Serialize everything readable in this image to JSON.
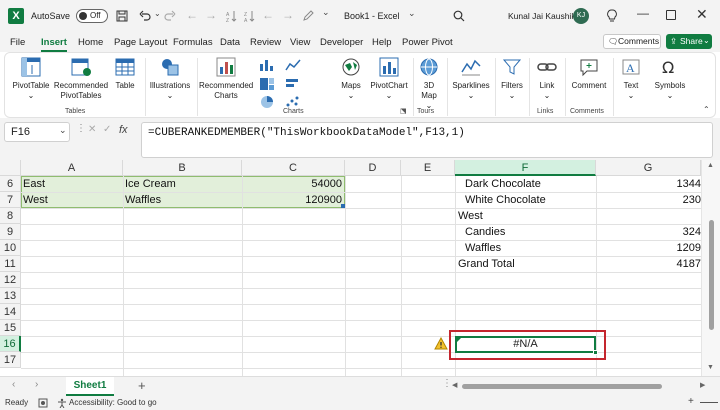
{
  "titlebar": {
    "autosave_label": "AutoSave",
    "autosave_state": "Off",
    "doc_title": "Book1 - Excel",
    "user_name": "Kunal Jai Kaushik",
    "user_initials": "KJ"
  },
  "menu": {
    "tabs": [
      "File",
      "Insert",
      "Home",
      "Page Layout",
      "Formulas",
      "Data",
      "Review",
      "View",
      "Developer",
      "Help",
      "Power Pivot"
    ],
    "active": "Insert",
    "comments_label": "Comments",
    "share_label": "Share"
  },
  "ribbon": {
    "pivottable": "PivotTable",
    "recommended_pivottables_1": "Recommended",
    "recommended_pivottables_2": "PivotTables",
    "table": "Table",
    "group_tables": "Tables",
    "illustrations": "Illustrations",
    "recommended_charts_1": "Recommended",
    "recommended_charts_2": "Charts",
    "maps": "Maps",
    "pivotchart": "PivotChart",
    "group_charts": "Charts",
    "map3d_1": "3D",
    "map3d_2": "Map",
    "group_tours": "Tours",
    "sparklines": "Sparklines",
    "filters": "Filters",
    "link": "Link",
    "group_links": "Links",
    "comment": "Comment",
    "group_comments": "Comments",
    "text": "Text",
    "symbols": "Symbols"
  },
  "formula_bar": {
    "name_box": "F16",
    "fx": "fx",
    "formula": "=CUBERANKEDMEMBER(\"ThisWorkbookDataModel\",F13,1)"
  },
  "grid": {
    "columns": [
      "A",
      "B",
      "C",
      "D",
      "E",
      "F",
      "G"
    ],
    "selected_column": "F",
    "rows": [
      "6",
      "7",
      "8",
      "9",
      "10",
      "11",
      "12",
      "13",
      "14",
      "15",
      "16",
      "17"
    ],
    "selected_row": "16",
    "left_table": [
      {
        "region": "East",
        "product": "Ice Cream",
        "amount": "54000"
      },
      {
        "region": "West",
        "product": "Waffles",
        "amount": "120900"
      }
    ],
    "pivot": [
      {
        "label": "Dark Chocolate",
        "value": "1344",
        "indent": true
      },
      {
        "label": "White Chocolate",
        "value": "230",
        "indent": true
      },
      {
        "label": "West",
        "value": "",
        "indent": false
      },
      {
        "label": "Candies",
        "value": "324",
        "indent": true
      },
      {
        "label": "Waffles",
        "value": "1209",
        "indent": true
      },
      {
        "label": "Grand Total",
        "value": "4187",
        "indent": false
      }
    ],
    "error_value": "#N/A"
  },
  "sheets": {
    "active": "Sheet1",
    "add_label": "+"
  },
  "status": {
    "ready": "Ready",
    "accessibility": "Accessibility: Good to go"
  },
  "colors": {
    "accent": "#107c41",
    "highlight_fill": "#e2efda",
    "error_box": "#c4262e"
  }
}
